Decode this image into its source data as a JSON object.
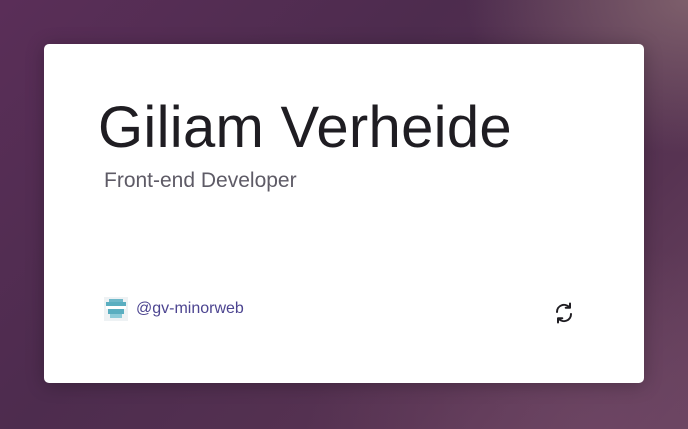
{
  "card": {
    "name": "Giliam Verheide",
    "role": "Front-end Developer",
    "handle": {
      "text": "@gv-minorweb",
      "avatar_icon": "pixel-avatar-icon"
    },
    "flip_icon": "refresh-arrows-icon"
  },
  "colors": {
    "name_text": "#1f1d22",
    "role_text": "#5e5b66",
    "handle_text": "#4c4490",
    "avatar_teal": "#5aaec0",
    "background": "#4d2c4e"
  }
}
